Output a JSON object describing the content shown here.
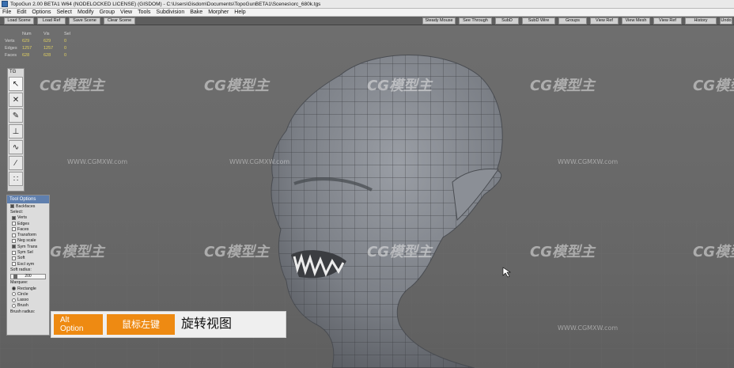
{
  "window": {
    "title": "TopoGun 2.00 BETA1 W64  (NODELOCKED LICENSE) (GISDOM) - C:\\Users\\Gisdom\\Documents\\TopoGunBETA1\\Scenes\\orc_680k.tgs"
  },
  "menu": [
    "File",
    "Edit",
    "Options",
    "Select",
    "Modify",
    "Group",
    "View",
    "Tools",
    "Subdivision",
    "Bake",
    "Morpher",
    "Help"
  ],
  "toolbar": {
    "left": [
      "Load Scene",
      "Load Ref",
      "Save Scene",
      "Clear Scene"
    ],
    "right": [
      "Steady Mouse",
      "See Through",
      "SubD",
      "SubD Wire",
      "Groups",
      "View Ref",
      "View Mesh",
      "View Ref",
      "History",
      "Undo"
    ]
  },
  "stats": {
    "headers": [
      "Num",
      "Vis",
      "Sel"
    ],
    "rows": [
      {
        "label": "Verts",
        "num": "629",
        "vis": "629",
        "sel": "0"
      },
      {
        "label": "Edges",
        "num": "1257",
        "vis": "1257",
        "sel": "0"
      },
      {
        "label": "Faces",
        "num": "628",
        "vis": "628",
        "sel": "0"
      }
    ]
  },
  "tg_panel": {
    "label": "TG",
    "tools": [
      "select-arrow-icon",
      "cross-icon",
      "pen-icon",
      "pin-icon",
      "brush-icon",
      "line-tool-icon",
      "tweak-icon"
    ]
  },
  "tool_options": {
    "title": "Tool Options",
    "backfaces": "Backfaces",
    "select_label": "Select:",
    "select_items": [
      {
        "label": "Verts",
        "checked": true
      },
      {
        "label": "Edges",
        "checked": false
      },
      {
        "label": "Faces",
        "checked": false
      }
    ],
    "options": [
      {
        "label": "Transform",
        "checked": false
      },
      {
        "label": "Neg scale",
        "checked": false
      },
      {
        "label": "Sym Trans",
        "checked": true
      },
      {
        "label": "Sym Sel",
        "checked": false
      },
      {
        "label": "Soft",
        "checked": false
      },
      {
        "label": "Excl sym",
        "checked": false
      }
    ],
    "soft_radius_label": "Soft radius:",
    "soft_radius_value": "200",
    "marquee_label": "Marquee:",
    "marquee_items": [
      {
        "label": "Rectangle",
        "selected": true
      },
      {
        "label": "Circle",
        "selected": false
      },
      {
        "label": "Lasso",
        "selected": false
      },
      {
        "label": "Brush",
        "selected": false
      }
    ],
    "brush_radius_label": "Brush radius:"
  },
  "caption": {
    "key1_line1": "Alt",
    "key1_line2": "Option",
    "key2": "鼠标左键",
    "text": "旋转视图"
  },
  "watermark": {
    "logo": "CG模型主",
    "url": "WWW.CGMXW.com"
  },
  "colors": {
    "viewport": "#6b6b6b",
    "caption_key": "#ee8a12",
    "panel_head": "#5f7fae",
    "mesh": "#7d8188"
  }
}
